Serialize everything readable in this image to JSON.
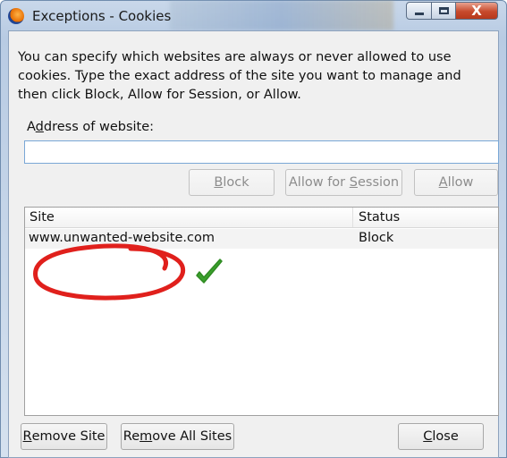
{
  "window": {
    "title": "Exceptions - Cookies",
    "controls": {
      "minimize": "minimize",
      "maximize": "maximize",
      "close_glyph": "X"
    }
  },
  "intro_text": "You can specify which websites are always or never allowed to use cookies. Type the exact address of the site you want to manage and then click Block, Allow for Session, or Allow.",
  "address": {
    "label_prefix": "A",
    "label_accel": "d",
    "label_rest": "dress of website:",
    "value": "",
    "placeholder": ""
  },
  "action_buttons": {
    "block": {
      "accel": "B",
      "rest": "lock"
    },
    "allow_session": {
      "pre": "Allow for ",
      "accel": "S",
      "rest": "ession"
    },
    "allow": {
      "accel": "A",
      "rest": "llow"
    }
  },
  "table": {
    "columns": [
      "Site",
      "Status"
    ],
    "rows": [
      {
        "site": "www.unwanted-website.com",
        "status": "Block"
      }
    ]
  },
  "bottom_buttons": {
    "remove_site": {
      "accel": "R",
      "rest": "emove Site"
    },
    "remove_all": {
      "pre": "Re",
      "accel": "m",
      "rest": "ove All Sites"
    },
    "close": {
      "accel": "C",
      "rest": "lose"
    }
  },
  "annotations": {
    "ellipse_color": "#e0201c",
    "checkmark_color": "#3aa02c",
    "checkmark_icon": "check-icon"
  },
  "colors": {
    "titlebar": "#b8cbe3",
    "client_bg": "#f0f0f0",
    "input_border": "#7aa7d6",
    "close_button": "#c74a2c"
  }
}
